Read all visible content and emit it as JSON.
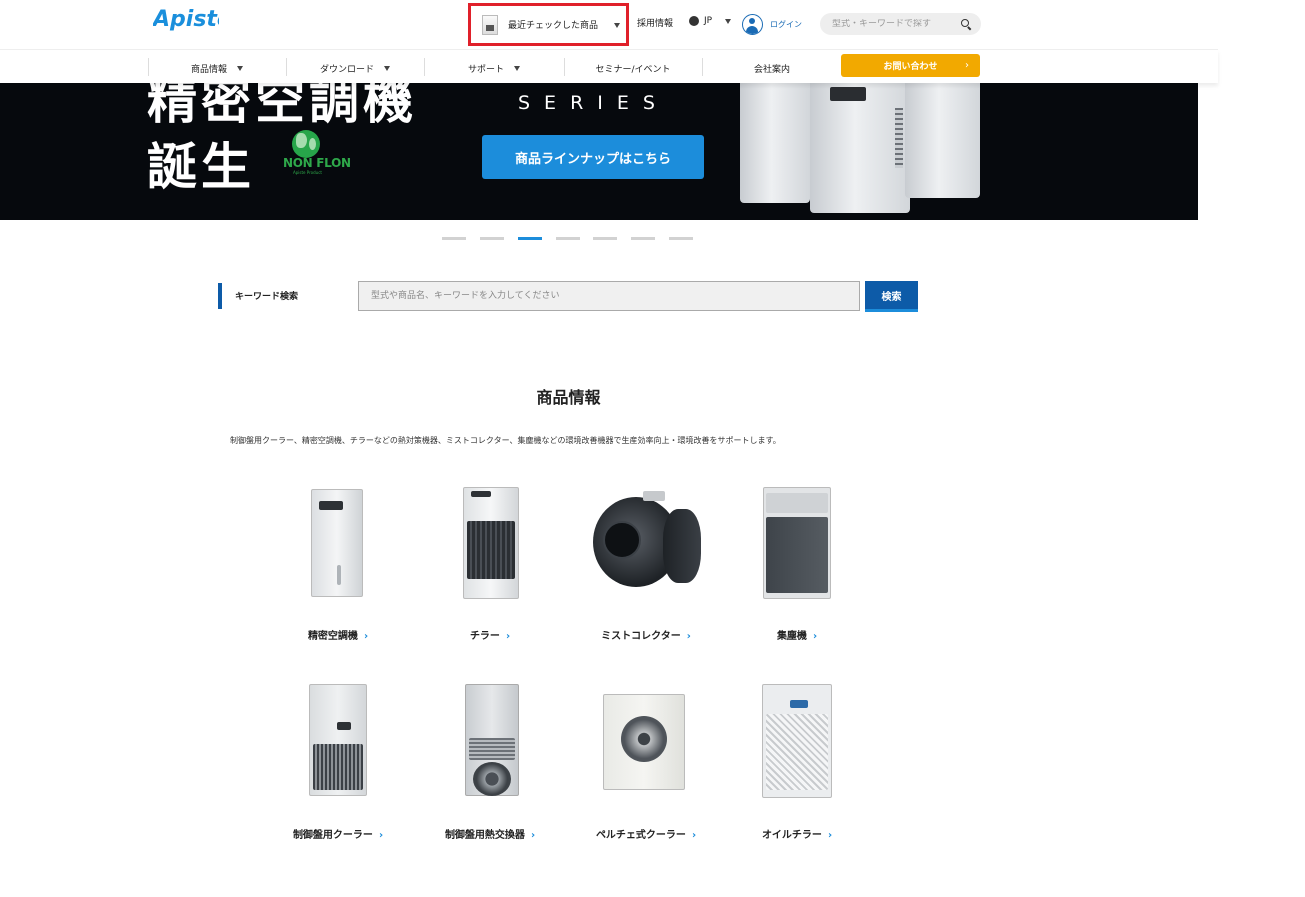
{
  "header": {
    "logo_text": "Apiste",
    "recent_label": "最近チェックした商品",
    "recruit_label": "採用情報",
    "lang_label": "JP",
    "login_label": "ログイン",
    "search_placeholder": "型式・キーワードで探す"
  },
  "nav": {
    "items": [
      {
        "label": "商品情報",
        "dropdown": true
      },
      {
        "label": "ダウンロード",
        "dropdown": true
      },
      {
        "label": "サポート",
        "dropdown": true
      },
      {
        "label": "セミナー/イベント",
        "dropdown": false
      },
      {
        "label": "会社案内",
        "dropdown": false
      }
    ],
    "inquiry_label": "お問い合わせ",
    "inquiry_color": "#f2a900"
  },
  "hero": {
    "headline_1": "精密空調機",
    "headline_2": "誕生",
    "badge_text": "NON FLON",
    "badge_sub": "Apiste Product",
    "series_text": "SERIES",
    "button_label": "商品ラインナップはこちら",
    "button_color": "#1c8ddb"
  },
  "carousel": {
    "count": 7,
    "active_index": 2
  },
  "keyword_search": {
    "label": "キーワード検索",
    "placeholder": "型式や商品名、キーワードを入力してください",
    "button_label": "検索"
  },
  "products": {
    "title": "商品情報",
    "description": "制御盤用クーラー、精密空調機、チラーなどの熱対策機器、ミストコレクター、集塵機などの環境改善機器で生産効率向上・環境改善をサポートします。",
    "items": [
      {
        "name": "精密空調機",
        "icon": "precision-air-conditioner"
      },
      {
        "name": "チラー",
        "icon": "chiller"
      },
      {
        "name": "ミストコレクター",
        "icon": "mist-collector"
      },
      {
        "name": "集塵機",
        "icon": "dust-collector"
      },
      {
        "name": "制御盤用クーラー",
        "icon": "enclosure-cooler"
      },
      {
        "name": "制御盤用熱交換器",
        "icon": "heat-exchanger"
      },
      {
        "name": "ペルチェ式クーラー",
        "icon": "peltier-cooler"
      },
      {
        "name": "オイルチラー",
        "icon": "oil-chiller"
      }
    ]
  },
  "colors": {
    "brand_blue": "#1c8ddb",
    "dark_blue": "#0d5ba8",
    "highlight_red": "#e0202a"
  }
}
